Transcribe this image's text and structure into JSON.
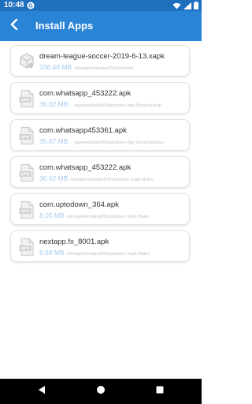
{
  "status_bar": {
    "time": "10:48",
    "icons": [
      "notification-icon",
      "wifi-icon",
      "signal-icon",
      "battery-icon"
    ]
  },
  "app_bar": {
    "title": "Install Apps",
    "back_icon": "back-arrow-icon"
  },
  "colors": {
    "status_bar": "#1f6fbf",
    "app_bar": "#2a84d6",
    "size_text": "#a7c9ec",
    "path_text": "#c2c2c2",
    "nav_bar": "#000000"
  },
  "files": [
    {
      "name": "dream-league-soccer-2019-6-13.xapk",
      "size": "336.48 MB",
      "path": "/storage/emulated/0/Download",
      "icon": "xapk-file-icon"
    },
    {
      "name": "com.whatsapp_453222.apk",
      "size": "36.02 MB",
      "path": "...rage/emulated/0/Uptodown App Store/backup",
      "icon": "apk-file-icon"
    },
    {
      "name": "com.whatsapp453361.apk",
      "size": "35.67 MB",
      "path": "...rage/emulated/0/Uptodown App Store/Updates",
      "icon": "apk-file-icon"
    },
    {
      "name": "com.whatsapp_453222.apk",
      "size": "36.02 MB",
      "path": "/storage/emulated/0/Uptodown Xapk Maker",
      "icon": "apk-file-icon"
    },
    {
      "name": "com.uptodown_364.apk",
      "size": "8.05 MB",
      "path": "/storage/emulated/0/Uptodown Xapk Maker",
      "icon": "apk-file-icon"
    },
    {
      "name": "nextapp.fx_8001.apk",
      "size": "8.69 MB",
      "path": "/storage/emulated/0/Uptodown Xapk Maker",
      "icon": "apk-file-icon"
    }
  ],
  "nav_bar": {
    "icons": [
      "back-triangle-icon",
      "home-circle-icon",
      "recents-square-icon"
    ]
  }
}
